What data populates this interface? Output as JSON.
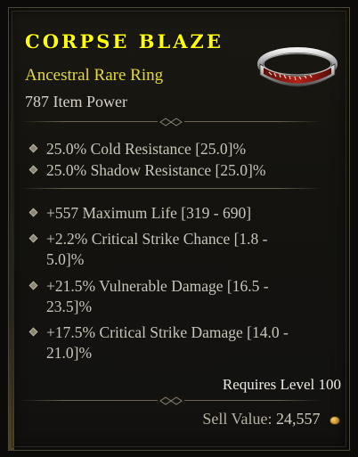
{
  "item": {
    "name": "CORPSE BLAZE",
    "type": "Ancestral Rare Ring",
    "power": "787 Item Power",
    "icon": "ring-icon",
    "name_color": "#ffff00",
    "type_color": "#e5d93a"
  },
  "implicit_affixes": [
    "25.0% Cold Resistance [25.0]%",
    "25.0% Shadow Resistance [25.0]%"
  ],
  "affixes": [
    {
      "line1": "+557 Maximum Life [319 - 690]",
      "line2": ""
    },
    {
      "line1": "+2.2% Critical Strike Chance [1.8 -",
      "line2": "5.0]%"
    },
    {
      "line1": "+21.5% Vulnerable Damage [16.5 -",
      "line2": "23.5]%"
    },
    {
      "line1": "+17.5% Critical Strike Damage [14.0 -",
      "line2": "21.0]%"
    }
  ],
  "requirements": "Requires Level 100",
  "sell": {
    "label": "Sell Value:",
    "value": "24,557",
    "icon": "gold-coin-icon"
  }
}
